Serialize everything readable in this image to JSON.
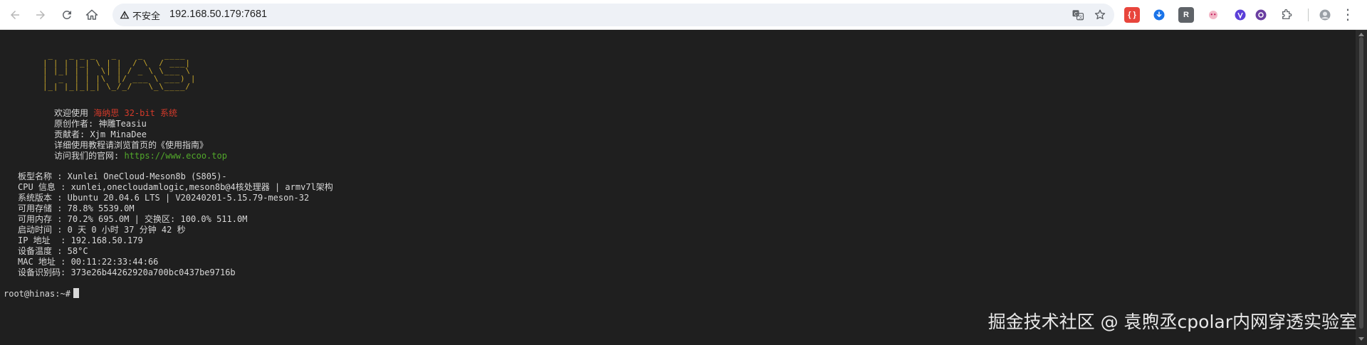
{
  "browser": {
    "url": "192.168.50.179:7681",
    "security_label": "不安全"
  },
  "terminal": {
    "logo_ascii": " _   _ _ _   _    _    ____\n| | | |_| \\ | |  / \\  / ___|\n| |_| | |  \\| | / _ \\ \\___ \\\n|  _  | | |\\  |/ ___ \\ ___) |\n|_| |_|_|_| \\_/_/   \\_\\____/",
    "welcome": {
      "prefix": "欢迎使用",
      "highlight": "海纳思 32-bit 系统"
    },
    "author_line": "原创作者: 神雕Teasiu",
    "contributor_line": "贡献者: Xjm MinaDee",
    "guide_line": "详细使用教程请浏览首页的《使用指南》",
    "website": {
      "prefix": "访问我们的官网: ",
      "url": "https://www.ecoo.top"
    },
    "info_lines": [
      "板型名称 : Xunlei OneCloud-Meson8b (S805)-",
      "CPU 信息 : xunlei,onecloudamlogic,meson8b@4核处理器 | armv7l架构",
      "系统版本 : Ubuntu 20.04.6 LTS | V20240201-5.15.79-meson-32",
      "可用存储 : 78.8% 5539.0M",
      "可用内存 : 70.2% 695.0M | 交换区: 100.0% 511.0M",
      "启动时间 : 0 天 0 小时 37 分钟 42 秒",
      "IP 地址  : 192.168.50.179",
      "设备温度 : 58°C",
      "MAC 地址 : 00:11:22:33:44:66",
      "设备识别码: 373e26b44262920a700bc0437be9716b"
    ],
    "prompt": "root@hinas:~#"
  },
  "watermark": "掘金技术社区 @ 袁煦丞cpolar内网穿透实验室",
  "colors": {
    "terminal_bg": "#1f1f1f",
    "logo": "#c7a62a",
    "highlight": "#d43a2a",
    "link": "#52a82b"
  }
}
